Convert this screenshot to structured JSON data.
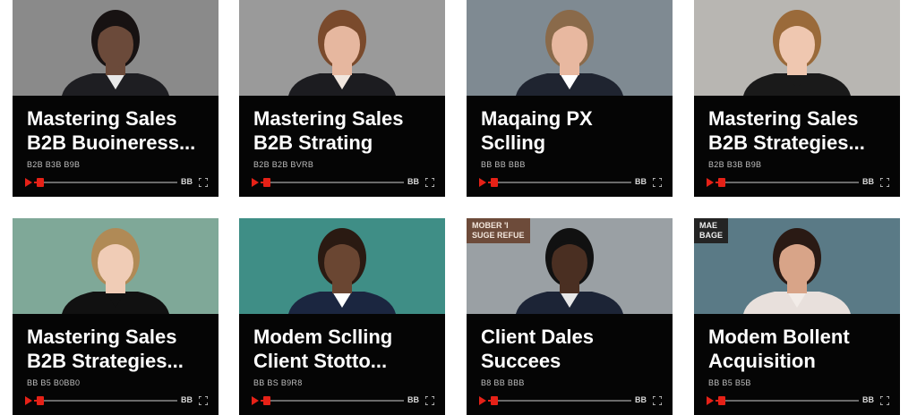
{
  "cards": [
    {
      "title": "Mastering Sales\nB2B Buoineress...",
      "meta": "B2B  B3B  B9B",
      "progress": 0.03,
      "control_label": "BB",
      "thumb": {
        "bg": "#8a8a8a",
        "skin": "#6b4a3a",
        "hair": "#171212",
        "suit": "#1e1e22",
        "shirt": "#e8e8e8"
      }
    },
    {
      "title": "Mastering Sales\nB2B Strating",
      "meta": "B2B  B2B  BVRB",
      "progress": 0.03,
      "control_label": "BB",
      "thumb": {
        "bg": "#9a9a9a",
        "skin": "#e6b79f",
        "hair": "#7a4a2c",
        "suit": "#1c1c20",
        "shirt": "#f0e6de"
      }
    },
    {
      "title": "Maqaing PX\nSclling",
      "meta": "BB  BB  BBB",
      "progress": 0.03,
      "control_label": "BB",
      "thumb": {
        "bg": "#7f8a92",
        "skin": "#e8b8a0",
        "hair": "#8a6a4a",
        "suit": "#1f2430",
        "shirt": "#ffffff"
      }
    },
    {
      "title": "Mastering Sales\nB2B Strategies...",
      "meta": "B2B  B3B  B9B",
      "progress": 0.03,
      "control_label": "BB",
      "thumb": {
        "bg": "#b8b6b2",
        "skin": "#efc7b0",
        "hair": "#9a6a3a",
        "suit": "#1a1a1a",
        "shirt": "#1a1a1a"
      }
    },
    {
      "title": "Mastering Sales\nB2B Strategies...",
      "meta": "BB  B5  B0BB0",
      "progress": 0.03,
      "control_label": "BB",
      "thumb": {
        "bg": "#7fa898",
        "skin": "#f0ccb6",
        "hair": "#b08a56",
        "suit": "#111111",
        "shirt": "#111111"
      }
    },
    {
      "title": "Modem Sclling\nClient Stotto...",
      "meta": "BB  BS  B9R8",
      "progress": 0.03,
      "control_label": "BB",
      "thumb": {
        "bg": "#3f8e86",
        "skin": "#6a4632",
        "hair": "#2a1a12",
        "suit": "#1b2640",
        "shirt": "#ffffff"
      }
    },
    {
      "title": "Client Dales\nSuccees",
      "meta": "B8  BB  BBB",
      "progress": 0.03,
      "control_label": "BB",
      "badge": "MOBER  'I\nSUGE  REFUE",
      "thumb": {
        "bg": "#9aa0a4",
        "skin": "#4a2f22",
        "hair": "#111111",
        "suit": "#1c2436",
        "shirt": "#e8e8e8"
      }
    },
    {
      "title": "Modem Bollent\nAcquisition",
      "meta": "BB  B5  B5B",
      "progress": 0.03,
      "control_label": "BB",
      "badge": "MAE\nBAGE",
      "badge_dark": true,
      "thumb": {
        "bg": "#5a7a86",
        "skin": "#d8a488",
        "hair": "#2a1a14",
        "suit": "#e8e0dc",
        "shirt": "#f2ece8"
      }
    }
  ]
}
